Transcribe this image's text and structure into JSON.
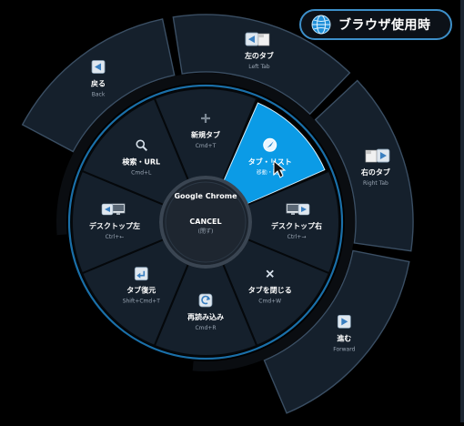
{
  "mode_badge": {
    "label": "ブラウザ使用時",
    "icon": "globe-icon"
  },
  "center": {
    "app_name": "Google Chrome",
    "cancel_label": "CANCEL",
    "cancel_sub": "(閉ず)"
  },
  "outer_items": [
    {
      "id": "back",
      "label": "戻る",
      "sub": "Back",
      "icon": "back-arrow-icon"
    },
    {
      "id": "left-tab",
      "label": "左のタブ",
      "sub": "Left Tab",
      "icon": "left-tab-icon"
    },
    {
      "id": "right-tab",
      "label": "右のタブ",
      "sub": "Right Tab",
      "icon": "right-tab-icon"
    },
    {
      "id": "forward",
      "label": "進む",
      "sub": "Forward",
      "icon": "forward-arrow-icon"
    }
  ],
  "inner_items": [
    {
      "id": "new-tab",
      "label": "新規タブ",
      "sub": "Cmd+T",
      "icon": "plus-icon"
    },
    {
      "id": "tab-list",
      "label": "タブ・リスト",
      "sub": "移動・削除",
      "icon": "compass-icon",
      "active": true
    },
    {
      "id": "desktop-right",
      "label": "デスクトップ右",
      "sub": "Ctrl+→",
      "icon": "desktop-right-icon"
    },
    {
      "id": "close-tab",
      "label": "タブを閉じる",
      "sub": "Cmd+W",
      "icon": "close-icon"
    },
    {
      "id": "reload",
      "label": "再読み込み",
      "sub": "Cmd+R",
      "icon": "reload-icon"
    },
    {
      "id": "restore-tab",
      "label": "タブ復元",
      "sub": "Shift+Cmd+T",
      "icon": "restore-icon"
    },
    {
      "id": "desktop-left",
      "label": "デスクトップ左",
      "sub": "Ctrl+←",
      "icon": "desktop-left-icon"
    },
    {
      "id": "search-url",
      "label": "検索・URL",
      "sub": "Cmd+L",
      "icon": "search-icon"
    }
  ],
  "colors": {
    "segment": "#15202c",
    "segment_border": "#3a4e63",
    "active": "#0b9be6",
    "ring_blue": "#1a6fa8",
    "center_ring": "#3a4552"
  }
}
